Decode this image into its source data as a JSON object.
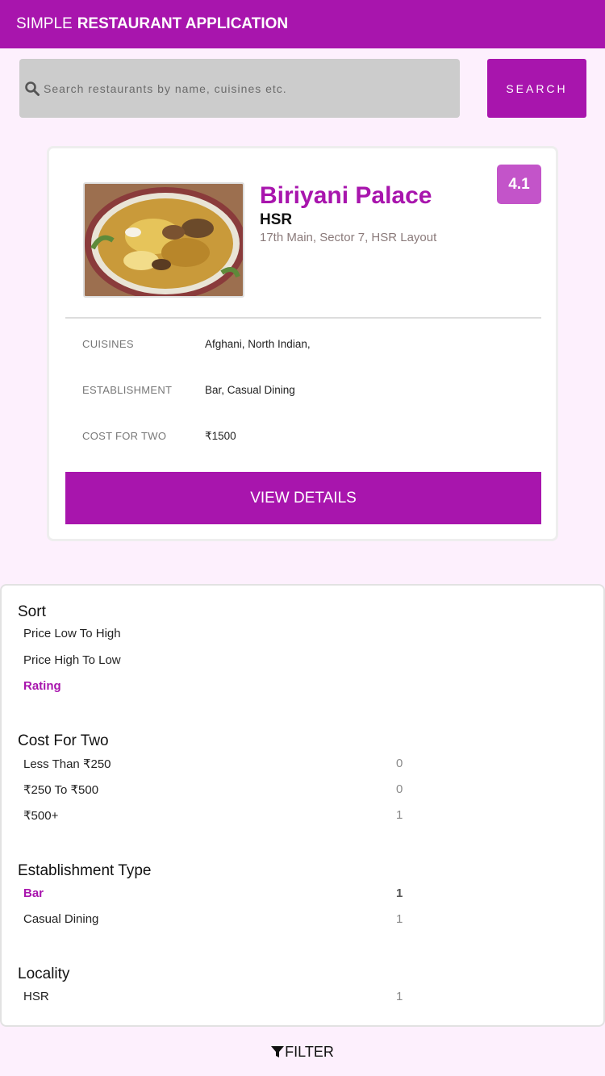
{
  "header": {
    "title_light": "SIMPLE",
    "title_bold": "RESTAURANT APPLICATION"
  },
  "search": {
    "placeholder": "Search restaurants by name, cuisines etc.",
    "button_label": "SEARCH"
  },
  "restaurant": {
    "name": "Biriyani Palace",
    "locality": "HSR",
    "address": "17th Main, Sector 7, HSR Layout",
    "rating": "4.1",
    "details": [
      {
        "label": "CUISINES",
        "value": "Afghani, North Indian,"
      },
      {
        "label": "ESTABLISHMENT",
        "value": "Bar, Casual Dining"
      },
      {
        "label": "COST FOR TWO",
        "value": "₹1500"
      }
    ],
    "view_button": "VIEW DETAILS"
  },
  "filters": {
    "sort": {
      "title": "Sort",
      "options": [
        {
          "label": "Price Low To High",
          "active": false
        },
        {
          "label": "Price High To Low",
          "active": false
        },
        {
          "label": "Rating",
          "active": true
        }
      ]
    },
    "cost": {
      "title": "Cost For Two",
      "options": [
        {
          "label": "Less Than ₹250",
          "count": "0"
        },
        {
          "label": "₹250 To ₹500",
          "count": "0"
        },
        {
          "label": "₹500+",
          "count": "1"
        }
      ]
    },
    "establishment": {
      "title": "Establishment Type",
      "options": [
        {
          "label": "Bar",
          "count": "1",
          "active": true
        },
        {
          "label": "Casual Dining",
          "count": "1",
          "active": false
        }
      ]
    },
    "locality": {
      "title": "Locality",
      "options": [
        {
          "label": "HSR",
          "count": "1"
        }
      ]
    }
  },
  "filter_toggle": {
    "label": "FILTER",
    "icon": "filter-icon"
  },
  "colors": {
    "accent": "#a815ad",
    "rating_bg": "#c354c9",
    "background": "#fdf0fd"
  }
}
